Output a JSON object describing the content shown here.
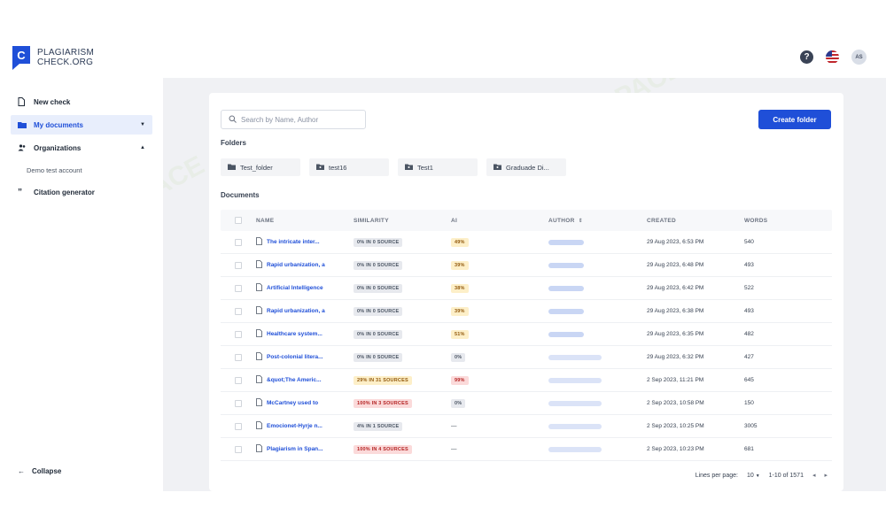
{
  "header": {
    "logo_line1": "PLAGIARISM",
    "logo_line2": "CHECK.ORG",
    "help_icon": "question-icon",
    "language_icon": "us-flag-icon",
    "avatar_initials": "AS"
  },
  "sidebar": {
    "items": [
      {
        "label": "New check",
        "icon": "file-icon"
      },
      {
        "label": "My documents",
        "icon": "folder-icon",
        "active": true
      },
      {
        "label": "Organizations",
        "icon": "users-icon"
      },
      {
        "label": "Citation generator",
        "icon": "quote-icon"
      }
    ],
    "org_sub": "Demo test account",
    "collapse_label": "Collapse"
  },
  "main": {
    "search_placeholder": "Search by Name, Author",
    "create_folder_label": "Create folder",
    "folders_label": "Folders",
    "documents_label": "Documents",
    "folders": [
      "Test_folder",
      "test16",
      "Test1",
      "Graduade Di..."
    ],
    "columns": {
      "name": "NAME",
      "similarity": "SIMILARITY",
      "ai": "AI",
      "author": "AUTHOR",
      "created": "CREATED",
      "words": "WORDS"
    },
    "rows": [
      {
        "name": "The intricate inter...",
        "similarity": "0% IN 0 SOURCE",
        "sim_level": "grey",
        "ai": "49%",
        "ai_level": "yellow",
        "created": "29 Aug 2023, 6:53 PM",
        "words": "540"
      },
      {
        "name": "Rapid urbanization, a",
        "similarity": "0% IN 0 SOURCE",
        "sim_level": "grey",
        "ai": "39%",
        "ai_level": "yellow",
        "created": "29 Aug 2023, 6:48 PM",
        "words": "493"
      },
      {
        "name": "Artificial Intelligence",
        "similarity": "0% IN 0 SOURCE",
        "sim_level": "grey",
        "ai": "38%",
        "ai_level": "yellow",
        "created": "29 Aug 2023, 6:42 PM",
        "words": "522"
      },
      {
        "name": "Rapid urbanization, a",
        "similarity": "0% IN 0 SOURCE",
        "sim_level": "grey",
        "ai": "39%",
        "ai_level": "yellow",
        "created": "29 Aug 2023, 6:38 PM",
        "words": "493"
      },
      {
        "name": "Healthcare system...",
        "similarity": "0% IN 0 SOURCE",
        "sim_level": "grey",
        "ai": "51%",
        "ai_level": "yellow",
        "created": "29 Aug 2023, 6:35 PM",
        "words": "482"
      },
      {
        "name": "Post-colonial litera...",
        "similarity": "0% IN 0 SOURCE",
        "sim_level": "grey",
        "ai": "0%",
        "ai_level": "grey",
        "created": "29 Aug 2023, 6:32 PM",
        "words": "427"
      },
      {
        "name": "&quot;The Americ...",
        "similarity": "29% IN 31 SOURCES",
        "sim_level": "yellow",
        "ai": "99%",
        "ai_level": "red",
        "created": "2 Sep 2023, 11:21 PM",
        "words": "645"
      },
      {
        "name": "McCartney used to",
        "similarity": "100% IN 3 SOURCES",
        "sim_level": "red",
        "ai": "0%",
        "ai_level": "grey",
        "created": "2 Sep 2023, 10:58 PM",
        "words": "150"
      },
      {
        "name": "Emocionet-Hyrje n...",
        "similarity": "4% IN 1 SOURCE",
        "sim_level": "grey",
        "ai": "—",
        "ai_level": "none",
        "created": "2 Sep 2023, 10:25 PM",
        "words": "3005"
      },
      {
        "name": "Plagiarism in Span...",
        "similarity": "100% IN 4 SOURCES",
        "sim_level": "red",
        "ai": "—",
        "ai_level": "none",
        "created": "2 Sep 2023, 10:23 PM",
        "words": "681"
      }
    ],
    "pager": {
      "lines_label": "Lines per page:",
      "lines_value": "10",
      "range": "1-10 of 1571"
    }
  },
  "watermark_text": "AI TALENT SPACE",
  "colors": {
    "accent": "#1f4fd8",
    "sidebar_active_bg": "#e8eefc"
  }
}
